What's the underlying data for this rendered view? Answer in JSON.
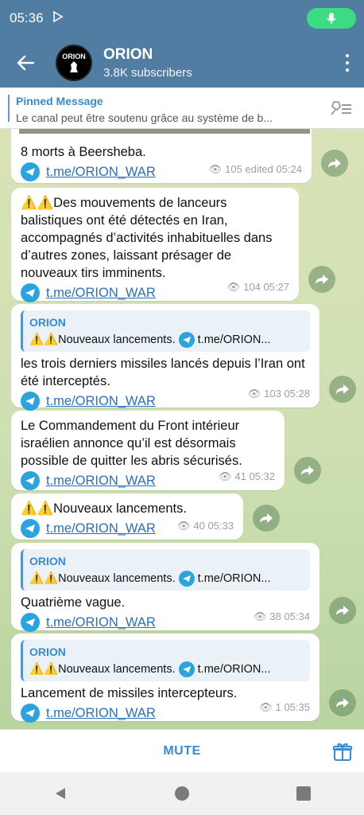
{
  "status": {
    "time": "05:36"
  },
  "header": {
    "title": "ORION",
    "subtitle": "3.8K subscribers",
    "avatar_text": "ORION"
  },
  "pinned": {
    "label": "Pinned Message",
    "text": "Le canal peut être soutenu grâce au système de b..."
  },
  "messages": [
    {
      "text": "8 morts à Beersheba.",
      "link": "t.me/ORION_WAR",
      "views": "105",
      "time": "edited 05:24"
    },
    {
      "text": "⚠️⚠️Des mouvements de lanceurs balistiques ont été détectés en Iran, accompagnés d’activités inhabituelles dans d’autres zones, laissant présager de nouveaux tirs imminents.",
      "link": "t.me/ORION_WAR",
      "views": "104",
      "time": "05:27"
    },
    {
      "quote_name": "ORION",
      "quote_text": "⚠️⚠️Nouveaux lancements.",
      "quote_link": "t.me/ORION...",
      "text": "les trois derniers missiles lancés depuis l’Iran ont été interceptés.",
      "link": "t.me/ORION_WAR",
      "views": "103",
      "time": "05:28"
    },
    {
      "text": "Le Commandement du Front intérieur israélien annonce qu’il est désormais possible de quitter les abris sécurisés.",
      "link": "t.me/ORION_WAR",
      "views": "41",
      "time": "05:32"
    },
    {
      "text": "⚠️⚠️Nouveaux lancements.",
      "link": "t.me/ORION_WAR",
      "views": "40",
      "time": "05:33"
    },
    {
      "quote_name": "ORION",
      "quote_text": "⚠️⚠️Nouveaux lancements.",
      "quote_link": "t.me/ORION...",
      "text": "Quatrième vague.",
      "link": "t.me/ORION_WAR",
      "views": "38",
      "time": "05:34"
    },
    {
      "quote_name": "ORION",
      "quote_text": "⚠️⚠️Nouveaux lancements.",
      "quote_link": "t.me/ORION...",
      "text": "Lancement de missiles intercepteurs.",
      "link": "t.me/ORION_WAR",
      "views": "1",
      "time": "05:35"
    }
  ],
  "bottom": {
    "mute": "MUTE"
  },
  "colors": {
    "header": "#517da2",
    "accent": "#3a8ad3",
    "link": "#2a6ebd"
  }
}
